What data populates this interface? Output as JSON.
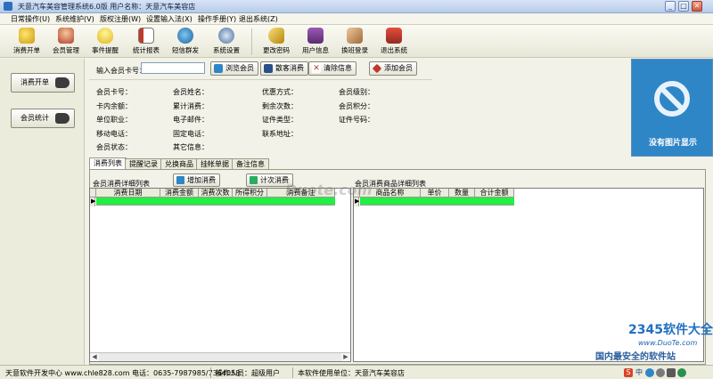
{
  "window": {
    "title": "天意汽车美容管理系统6.0版    用户名称：天意汽车美容店",
    "controls": [
      "minimize-icon",
      "maximize-icon",
      "close-icon"
    ]
  },
  "menu": [
    "日常操作(U)",
    "系统维护(V)",
    "版权注册(W)",
    "设置输入法(X)",
    "操作手册(Y)",
    "退出系统(Z)"
  ],
  "toolbar": [
    {
      "label": "消费开单",
      "icon": "coins-icon"
    },
    {
      "label": "会员管理",
      "icon": "member-icon"
    },
    {
      "label": "事件提醒",
      "icon": "bulb-icon"
    },
    {
      "label": "统计报表",
      "icon": "report-icon"
    },
    {
      "label": "短信群发",
      "icon": "sms-icon"
    },
    {
      "label": "系统设置",
      "icon": "settings-icon"
    },
    {
      "label": "更改密码",
      "icon": "key-icon"
    },
    {
      "label": "用户信息",
      "icon": "book-icon"
    },
    {
      "label": "换班登录",
      "icon": "handshake-icon"
    },
    {
      "label": "退出系统",
      "icon": "exit-icon"
    }
  ],
  "left_panel": {
    "consume_button": "消费开单",
    "stats_button": "会员统计"
  },
  "card_search": {
    "label": "输入会员卡号：",
    "value": "",
    "buttons": [
      "浏览会员",
      "散客消费",
      "清除信息",
      "添加会员"
    ]
  },
  "member_fields": [
    [
      "会员卡号：",
      "会员姓名：",
      "优惠方式：",
      "会员级别："
    ],
    [
      "卡内余额：",
      "累计消费：",
      "剩余次数：",
      "会员积分："
    ],
    [
      "单位职业：",
      "电子邮件：",
      "证件类型：",
      "证件号码："
    ],
    [
      "移动电话：",
      "固定电话：",
      "联系地址：",
      ""
    ],
    [
      "会员状态：",
      "其它信息：",
      "",
      ""
    ]
  ],
  "photo": {
    "text": "没有图片显示"
  },
  "tabs": [
    "消费列表",
    "提醒记录",
    "兑换商品",
    "挂帐单据",
    "备注信息"
  ],
  "left_grid": {
    "caption": "会员消费详细列表",
    "buttons": [
      "增加消费",
      "计次消费"
    ],
    "columns": [
      "消费日期",
      "消费金额",
      "消费次数",
      "所得积分",
      "消费备注"
    ]
  },
  "right_grid": {
    "caption": "会员消费商品详细列表",
    "columns": [
      "商品名称",
      "单价",
      "数量",
      "合计金额"
    ]
  },
  "status": {
    "company": "天意软件开发中心  www.chle828.com  电话：0635-7987985/7364058",
    "operator": "操作人员：超级用户",
    "unit": "本软件使用单位：天意汽车美容店"
  },
  "watermarks": {
    "center": "Duote.com",
    "brand": "2345软件大全",
    "site": "www.DuoTe.com",
    "slogan": "国内最安全的软件站"
  },
  "colors": {
    "grid_row": "#22ee44",
    "photo_bg": "#2f86c7",
    "menu_bg": "#f5f5ec",
    "window_bg": "#f2f2e8"
  }
}
